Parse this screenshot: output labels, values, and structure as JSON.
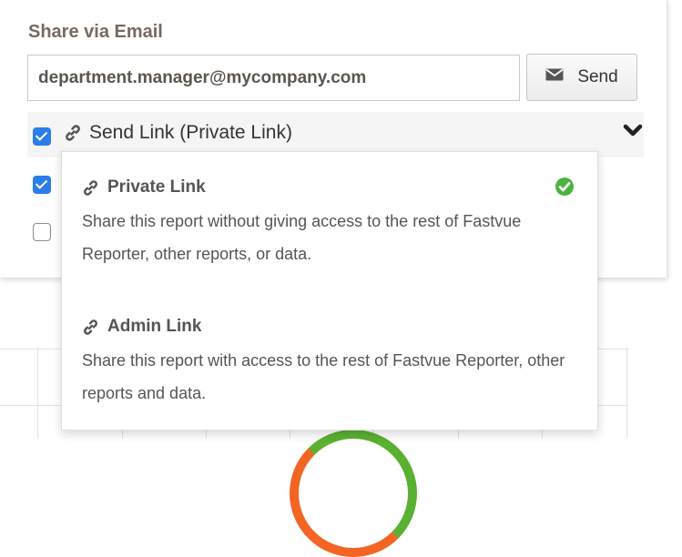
{
  "share": {
    "title": "Share via Email",
    "email_value": "department.manager@mycompany.com",
    "send_label": "Send"
  },
  "option": {
    "selected_label": "Send Link (Private Link)"
  },
  "menu": {
    "items": [
      {
        "label": "Private Link",
        "description": "Share this report without giving access to the rest of Fastvue Reporter, other reports, or data.",
        "selected": true
      },
      {
        "label": "Admin Link",
        "description": "Share this report with access to the rest of Fastvue Reporter, other reports and data.",
        "selected": false
      }
    ]
  },
  "checkboxes": [
    true,
    true,
    false
  ],
  "colors": {
    "accent": "#2b7de9",
    "success": "#4ab43c",
    "title": "#776a5e"
  },
  "icons": {
    "send": "envelope-icon",
    "link": "link-icon",
    "dropdown": "chevron-down-icon",
    "selected": "check-circle-icon"
  }
}
